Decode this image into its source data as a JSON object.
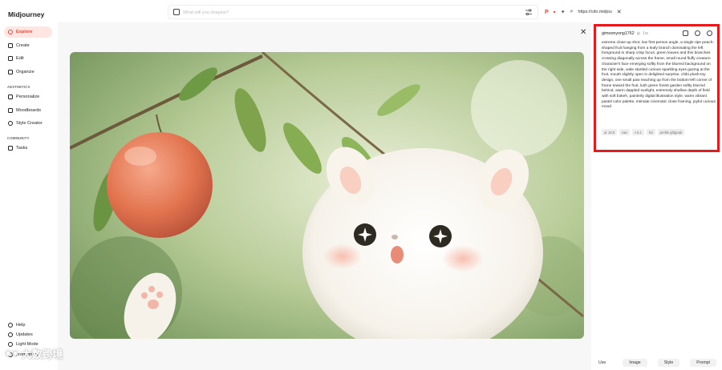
{
  "brand": "Midjourney",
  "sidebar": {
    "items": [
      {
        "label": "Explore",
        "icon": "compass-icon"
      },
      {
        "label": "Create",
        "icon": "edit-icon"
      },
      {
        "label": "Edit",
        "icon": "pencil-icon"
      },
      {
        "label": "Organize",
        "icon": "folder-icon"
      }
    ],
    "aesthetics_title": "AESTHETICS",
    "aesthetics_items": [
      {
        "label": "Personalize",
        "icon": "sliders-icon"
      },
      {
        "label": "Moodboards",
        "icon": "grid-icon"
      },
      {
        "label": "Style Creator",
        "icon": "palette-icon"
      }
    ],
    "community_title": "COMMUNITY",
    "community_items": [
      {
        "label": "Tasks",
        "icon": "thumbs-up-icon"
      }
    ],
    "footer": [
      {
        "label": "Help",
        "icon": "help-icon"
      },
      {
        "label": "Updates",
        "icon": "bell-icon"
      },
      {
        "label": "Light Mode",
        "icon": "sun-icon"
      },
      {
        "label": "prometheus",
        "icon": "avatar-icon"
      }
    ]
  },
  "search": {
    "placeholder": "What will you imagine?"
  },
  "toolbar": {
    "url": "https://cdn.midjou"
  },
  "panel": {
    "username": "gimoonyong1762",
    "time": "1w",
    "prompt": "extreme close-up shot, low first-person angle, a single ripe peach-shaped fruit hanging from a leafy branch dominating the left foreground in sharp crisp focus, green leaves and thin branches crossing diagonally across the frame, small round fluffy creature character's face emerging softly from the blurred background on the right side, wide startled curious sparkling eyes gazing at the fruit, mouth slightly open in delighted surprise, chibi plush-toy design, one small paw reaching up from the bottom-left corner of frame toward the fruit, lush green forest garden softly blurred behind, warm dappled sunlight, extremely shallow depth of field with soft bokeh, painterly digital illustration style, warm vibrant pastel color palette, intimate cinematic close framing, joyful curious mood",
    "chips": [
      "ar 16:9",
      "raw",
      "v 8.1",
      "hd",
      "profile gfdgoab"
    ]
  },
  "actions": [
    "Use",
    "Image",
    "Style",
    "Prompt"
  ],
  "watermark": "大数跨境",
  "colors": {
    "accent": "#e04a3b",
    "highlight_border": "#e8191a"
  }
}
